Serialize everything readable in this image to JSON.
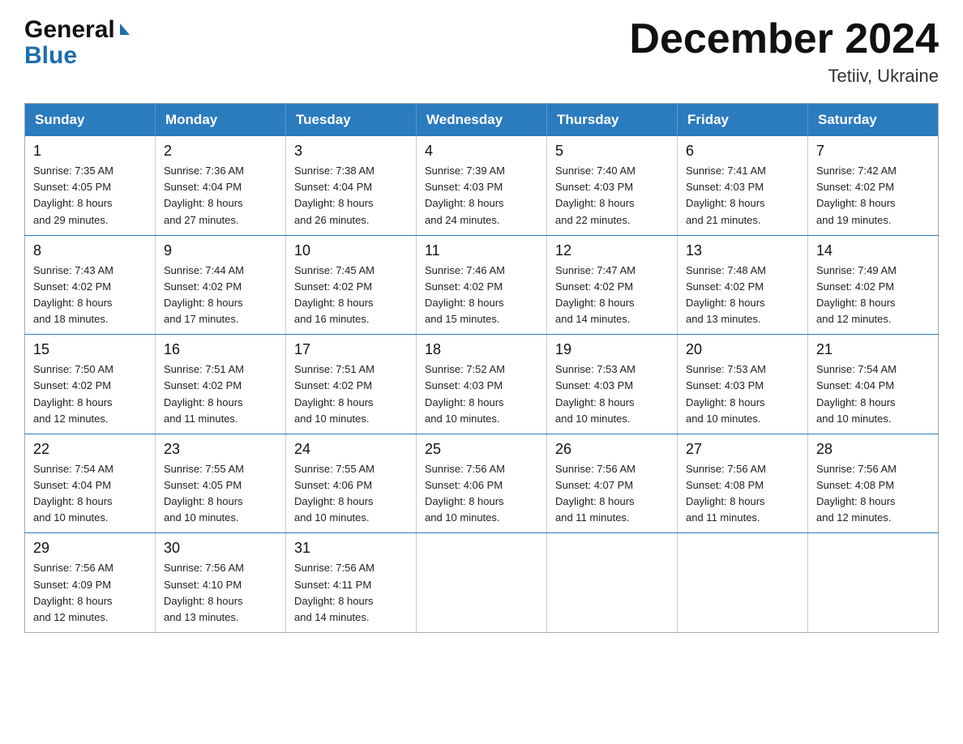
{
  "header": {
    "logo_general": "General",
    "logo_blue": "Blue",
    "month_title": "December 2024",
    "location": "Tetiiv, Ukraine"
  },
  "columns": [
    "Sunday",
    "Monday",
    "Tuesday",
    "Wednesday",
    "Thursday",
    "Friday",
    "Saturday"
  ],
  "weeks": [
    [
      {
        "day": "1",
        "sunrise": "7:35 AM",
        "sunset": "4:05 PM",
        "daylight": "8 hours and 29 minutes."
      },
      {
        "day": "2",
        "sunrise": "7:36 AM",
        "sunset": "4:04 PM",
        "daylight": "8 hours and 27 minutes."
      },
      {
        "day": "3",
        "sunrise": "7:38 AM",
        "sunset": "4:04 PM",
        "daylight": "8 hours and 26 minutes."
      },
      {
        "day": "4",
        "sunrise": "7:39 AM",
        "sunset": "4:03 PM",
        "daylight": "8 hours and 24 minutes."
      },
      {
        "day": "5",
        "sunrise": "7:40 AM",
        "sunset": "4:03 PM",
        "daylight": "8 hours and 22 minutes."
      },
      {
        "day": "6",
        "sunrise": "7:41 AM",
        "sunset": "4:03 PM",
        "daylight": "8 hours and 21 minutes."
      },
      {
        "day": "7",
        "sunrise": "7:42 AM",
        "sunset": "4:02 PM",
        "daylight": "8 hours and 19 minutes."
      }
    ],
    [
      {
        "day": "8",
        "sunrise": "7:43 AM",
        "sunset": "4:02 PM",
        "daylight": "8 hours and 18 minutes."
      },
      {
        "day": "9",
        "sunrise": "7:44 AM",
        "sunset": "4:02 PM",
        "daylight": "8 hours and 17 minutes."
      },
      {
        "day": "10",
        "sunrise": "7:45 AM",
        "sunset": "4:02 PM",
        "daylight": "8 hours and 16 minutes."
      },
      {
        "day": "11",
        "sunrise": "7:46 AM",
        "sunset": "4:02 PM",
        "daylight": "8 hours and 15 minutes."
      },
      {
        "day": "12",
        "sunrise": "7:47 AM",
        "sunset": "4:02 PM",
        "daylight": "8 hours and 14 minutes."
      },
      {
        "day": "13",
        "sunrise": "7:48 AM",
        "sunset": "4:02 PM",
        "daylight": "8 hours and 13 minutes."
      },
      {
        "day": "14",
        "sunrise": "7:49 AM",
        "sunset": "4:02 PM",
        "daylight": "8 hours and 12 minutes."
      }
    ],
    [
      {
        "day": "15",
        "sunrise": "7:50 AM",
        "sunset": "4:02 PM",
        "daylight": "8 hours and 12 minutes."
      },
      {
        "day": "16",
        "sunrise": "7:51 AM",
        "sunset": "4:02 PM",
        "daylight": "8 hours and 11 minutes."
      },
      {
        "day": "17",
        "sunrise": "7:51 AM",
        "sunset": "4:02 PM",
        "daylight": "8 hours and 10 minutes."
      },
      {
        "day": "18",
        "sunrise": "7:52 AM",
        "sunset": "4:03 PM",
        "daylight": "8 hours and 10 minutes."
      },
      {
        "day": "19",
        "sunrise": "7:53 AM",
        "sunset": "4:03 PM",
        "daylight": "8 hours and 10 minutes."
      },
      {
        "day": "20",
        "sunrise": "7:53 AM",
        "sunset": "4:03 PM",
        "daylight": "8 hours and 10 minutes."
      },
      {
        "day": "21",
        "sunrise": "7:54 AM",
        "sunset": "4:04 PM",
        "daylight": "8 hours and 10 minutes."
      }
    ],
    [
      {
        "day": "22",
        "sunrise": "7:54 AM",
        "sunset": "4:04 PM",
        "daylight": "8 hours and 10 minutes."
      },
      {
        "day": "23",
        "sunrise": "7:55 AM",
        "sunset": "4:05 PM",
        "daylight": "8 hours and 10 minutes."
      },
      {
        "day": "24",
        "sunrise": "7:55 AM",
        "sunset": "4:06 PM",
        "daylight": "8 hours and 10 minutes."
      },
      {
        "day": "25",
        "sunrise": "7:56 AM",
        "sunset": "4:06 PM",
        "daylight": "8 hours and 10 minutes."
      },
      {
        "day": "26",
        "sunrise": "7:56 AM",
        "sunset": "4:07 PM",
        "daylight": "8 hours and 11 minutes."
      },
      {
        "day": "27",
        "sunrise": "7:56 AM",
        "sunset": "4:08 PM",
        "daylight": "8 hours and 11 minutes."
      },
      {
        "day": "28",
        "sunrise": "7:56 AM",
        "sunset": "4:08 PM",
        "daylight": "8 hours and 12 minutes."
      }
    ],
    [
      {
        "day": "29",
        "sunrise": "7:56 AM",
        "sunset": "4:09 PM",
        "daylight": "8 hours and 12 minutes."
      },
      {
        "day": "30",
        "sunrise": "7:56 AM",
        "sunset": "4:10 PM",
        "daylight": "8 hours and 13 minutes."
      },
      {
        "day": "31",
        "sunrise": "7:56 AM",
        "sunset": "4:11 PM",
        "daylight": "8 hours and 14 minutes."
      },
      null,
      null,
      null,
      null
    ]
  ],
  "labels": {
    "sunrise": "Sunrise: ",
    "sunset": "Sunset: ",
    "daylight": "Daylight: "
  }
}
